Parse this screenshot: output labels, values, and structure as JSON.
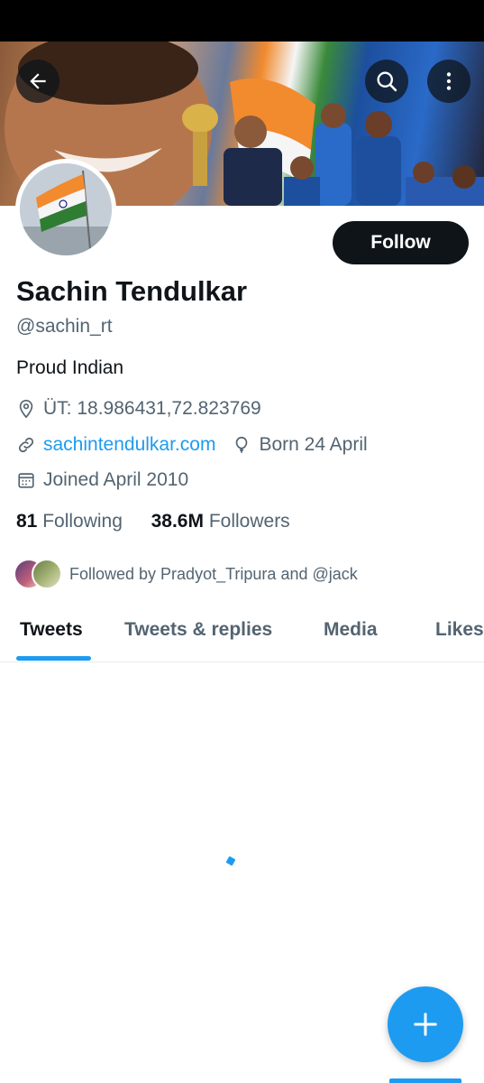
{
  "header": {
    "back_icon": "arrow-left-icon",
    "search_icon": "search-icon",
    "more_icon": "more-vertical-icon"
  },
  "profile": {
    "name": "Sachin Tendulkar",
    "handle": "@sachin_rt",
    "bio": "Proud Indian",
    "location": "ÜT: 18.986431,72.823769",
    "website": "sachintendulkar.com",
    "birthday": "Born 24 April",
    "joined": "Joined April 2010",
    "follow_label": "Follow"
  },
  "stats": {
    "following_count": "81",
    "following_label": "Following",
    "followers_count": "38.6M",
    "followers_label": "Followers"
  },
  "followed_by": {
    "text": "Followed by Pradyot_Tripura and @jack"
  },
  "tabs": [
    {
      "label": "Tweets",
      "active": true
    },
    {
      "label": "Tweets & replies",
      "active": false
    },
    {
      "label": "Media",
      "active": false
    },
    {
      "label": "Likes",
      "active": false
    }
  ],
  "colors": {
    "accent": "#1d9bf0",
    "text_primary": "#0f1419",
    "text_secondary": "#536471"
  }
}
